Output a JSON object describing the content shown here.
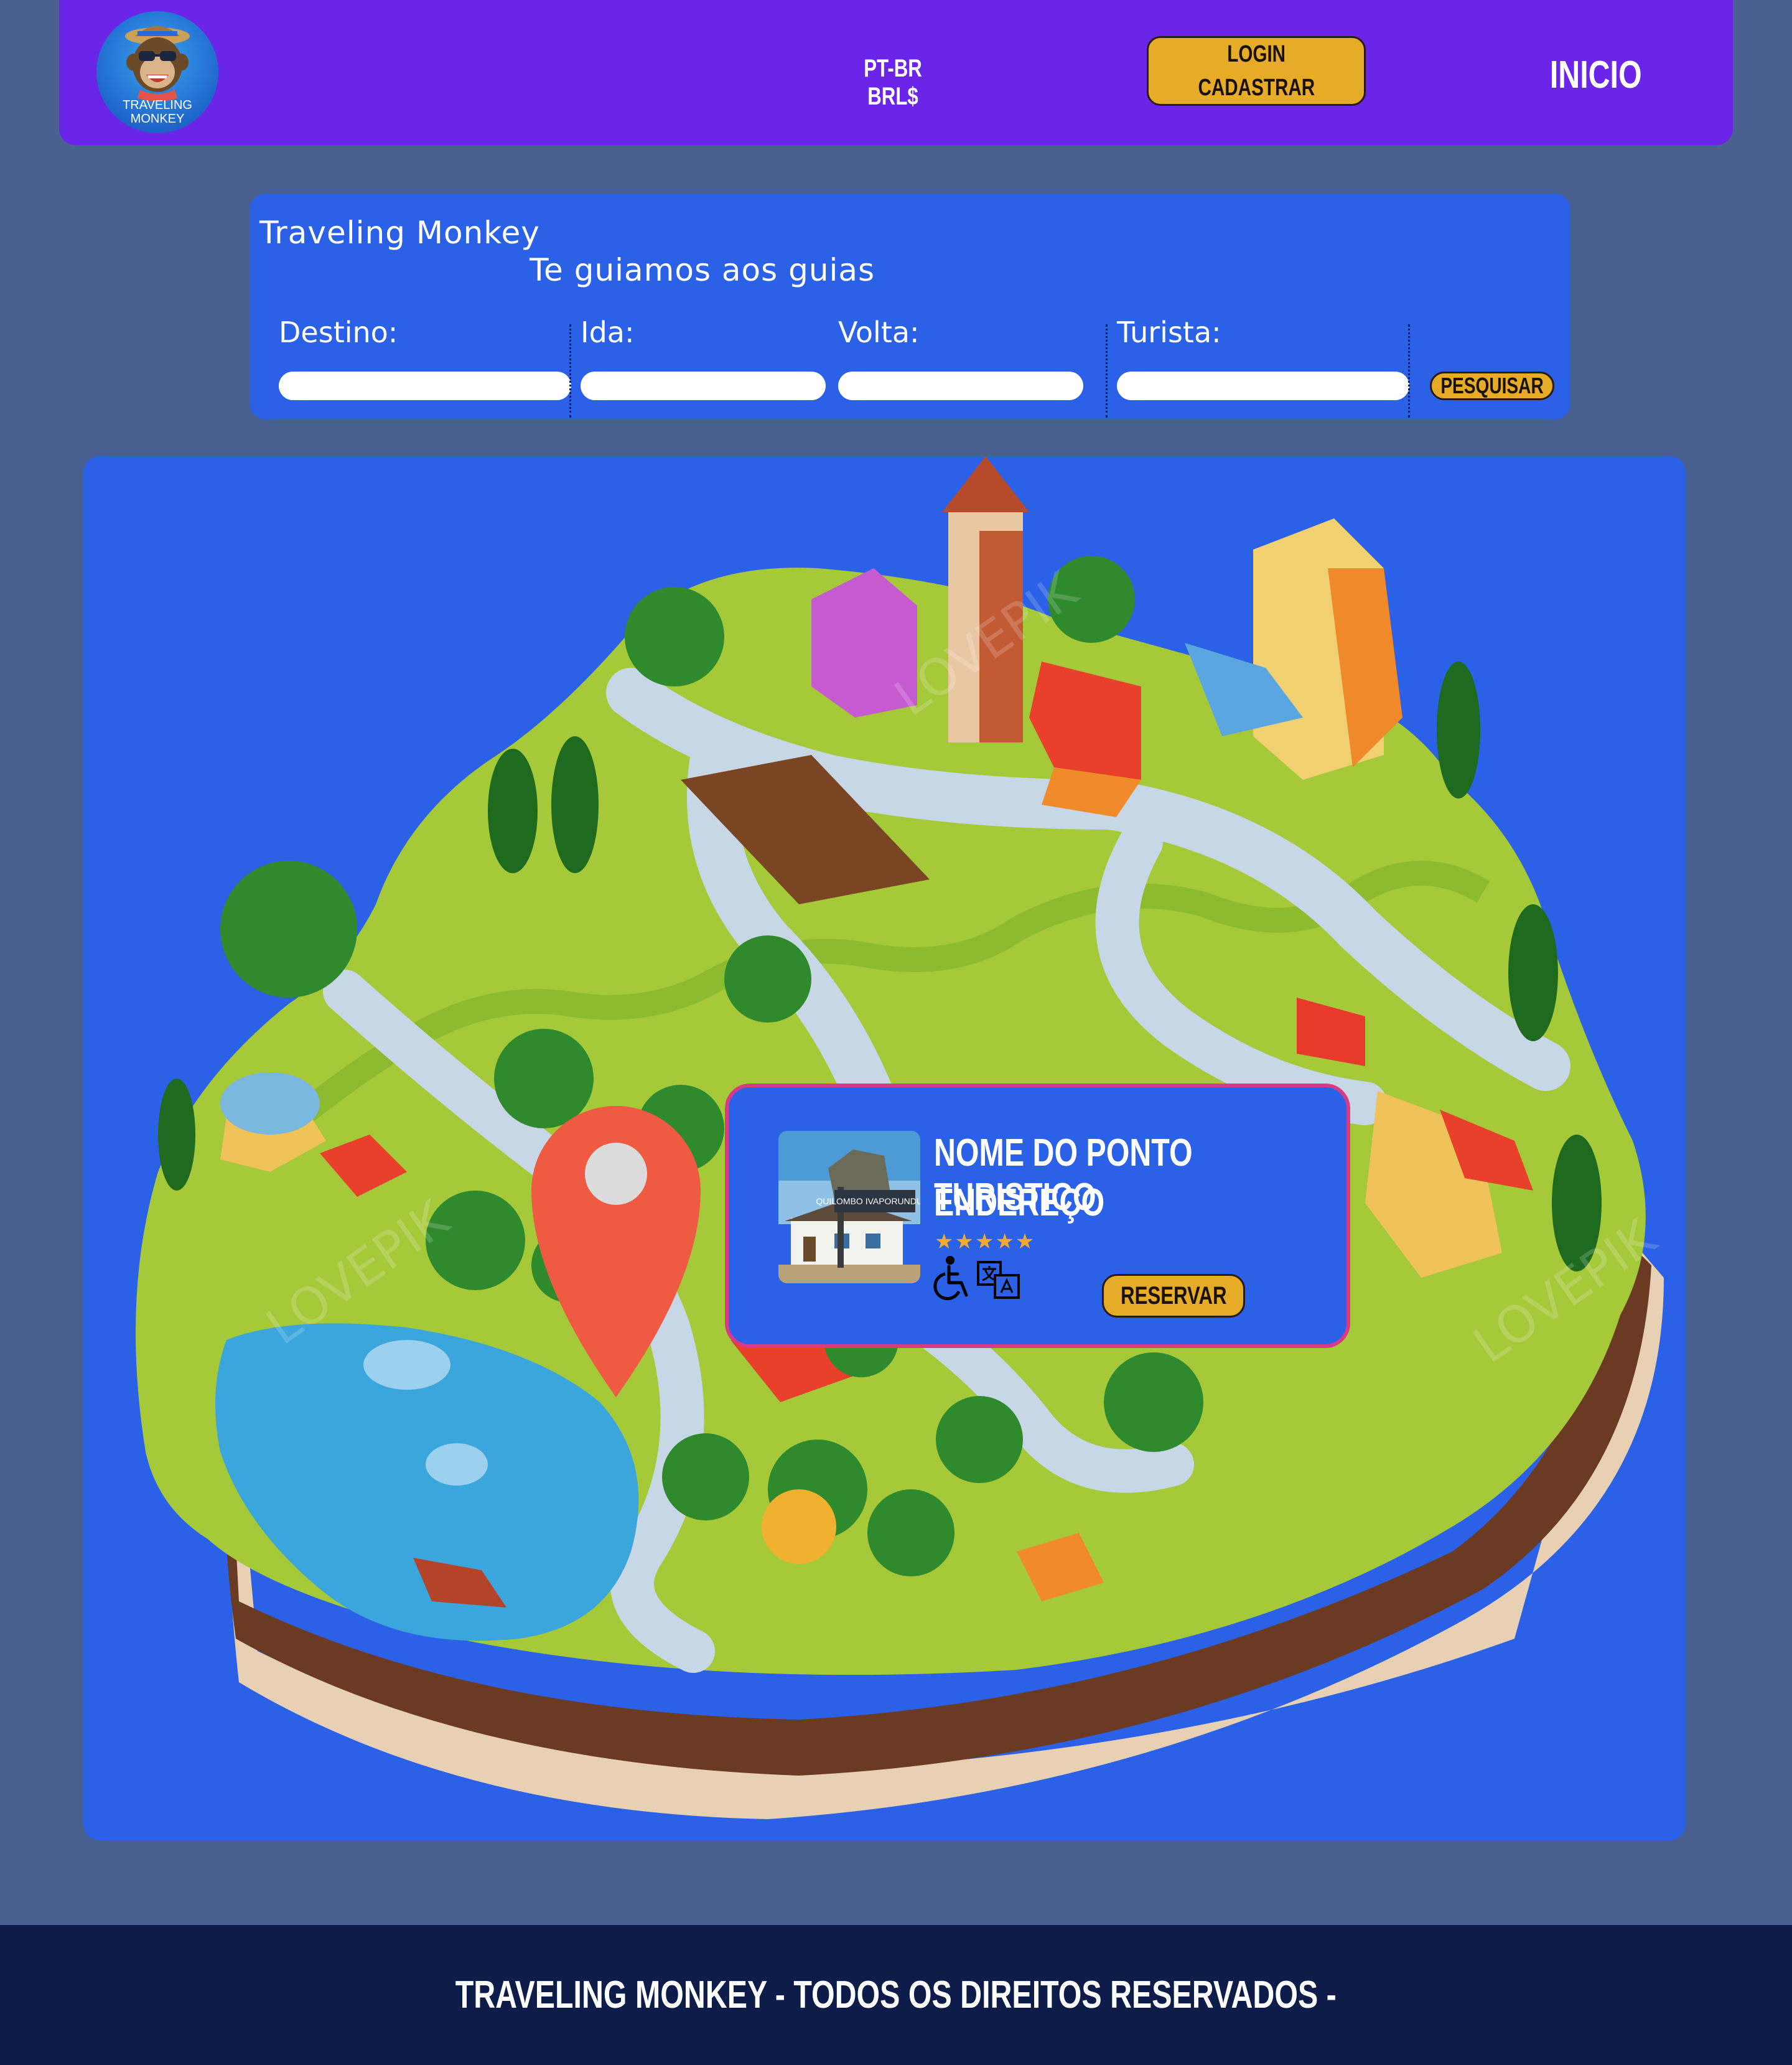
{
  "header": {
    "logo_text": "TRAVELING MONKEY",
    "language_currency": "PT-BR BRL$",
    "login_label": "LOGIN",
    "register_label": "CADASTRAR",
    "home_label": "INICIO"
  },
  "search": {
    "brand": "Traveling Monkey",
    "tagline": "Te guiamos aos guias",
    "destination_label": "Destino:",
    "departure_label": "Ida:",
    "return_label": "Volta:",
    "tourist_label": "Turista:",
    "destination_value": "",
    "departure_value": "",
    "return_value": "",
    "tourist_value": "",
    "search_label": "PESQUISAR"
  },
  "map": {
    "watermark": "LOVEPIK",
    "photo_sign_text": "QUILOMBO IVAPORUNDUVA"
  },
  "popup": {
    "name": "NOME DO PONTO TURISTICO",
    "address": "ENDEREÇO",
    "rating": 5,
    "stars": "★★★★★",
    "features": [
      "wheelchair-accessible-icon",
      "translation-icon"
    ],
    "reserve_label": "RESERVAR"
  },
  "footer": {
    "text": "TRAVELING MONKEY - TODOS OS DIREITOS RESERVADOS -"
  },
  "colors": {
    "background": "#4a6091",
    "header": "#6a25e8",
    "panel": "#2b61e6",
    "button": "#e6ac27",
    "popup_border": "#d83a86",
    "footer": "#0d1c48"
  }
}
